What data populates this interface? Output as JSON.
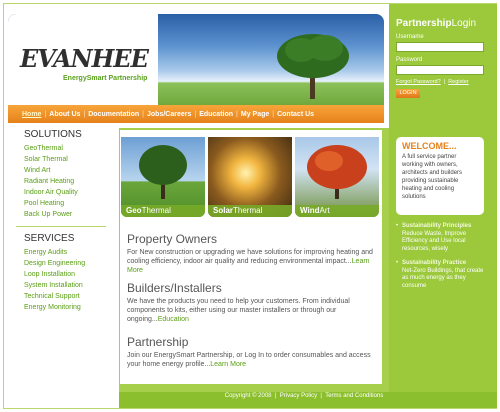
{
  "logo": {
    "text": "EVANHEE",
    "tagline": "EnergySmart Partnership"
  },
  "nav": {
    "items": [
      "Home",
      "About Us",
      "Documentation",
      "Jobs/Careers",
      "Education",
      "My Page",
      "Contact Us"
    ]
  },
  "login": {
    "title_bold": "Partnership",
    "title_light": "Login",
    "username_label": "Username",
    "password_label": "Password",
    "forgot": "Forgot Password?",
    "register": "Register",
    "button": "LOGIN"
  },
  "solutions": {
    "heading": "SOLUTIONS",
    "items": [
      "GeoThermal",
      "Solar Thermal",
      "Wind Art",
      "Radiant Heating",
      "Indoor Air Quality",
      "Pool Heating",
      "Back Up Power"
    ]
  },
  "services": {
    "heading": "SERVICES",
    "items": [
      "Energy Audits",
      "Design Engineering",
      "Loop Installation",
      "System Installation",
      "Technical Support",
      "Energy Monitoring"
    ]
  },
  "photos": [
    {
      "bold": "Geo",
      "light": "Thermal"
    },
    {
      "bold": "Solar",
      "light": "Thermal"
    },
    {
      "bold": "Wind",
      "light": "Art"
    }
  ],
  "sections": [
    {
      "title": "Property Owners",
      "text": "For New construction or upgrading we have solutions for improving heating and cooling efficiency, indoor air quality and reducing environmental impact...",
      "link": "Learn More"
    },
    {
      "title": "Builders/Installers",
      "text": "We have the products you need to help your customers. From individual components to kits, either using our master installers or through our ongoing...",
      "link": "Education"
    },
    {
      "title": "Partnership",
      "text": "Join our EnergySmart Partnership, or Log In to order consumables and access your home energy profile...",
      "link": "Learn More"
    }
  ],
  "welcome": {
    "heading": "WELCOME...",
    "text": "A full service partner working with owners, architects and builders providing sustainable heating and cooling solutions"
  },
  "principles": [
    {
      "title": "Sustainability Principles",
      "text": "Reduce Waste, Improve Efficiency and Use local resources, wisely"
    },
    {
      "title": "Sustainability Practice",
      "text": "Net-Zero Buildings, that create as much energy as they consume"
    }
  ],
  "footer": {
    "copyright": "Copyright © 2008",
    "privacy": "Privacy Policy",
    "terms": "Terms and Conditions"
  },
  "colors": {
    "green": "#9bc93b",
    "orange": "#e6811a",
    "link_green": "#5a9e16"
  }
}
